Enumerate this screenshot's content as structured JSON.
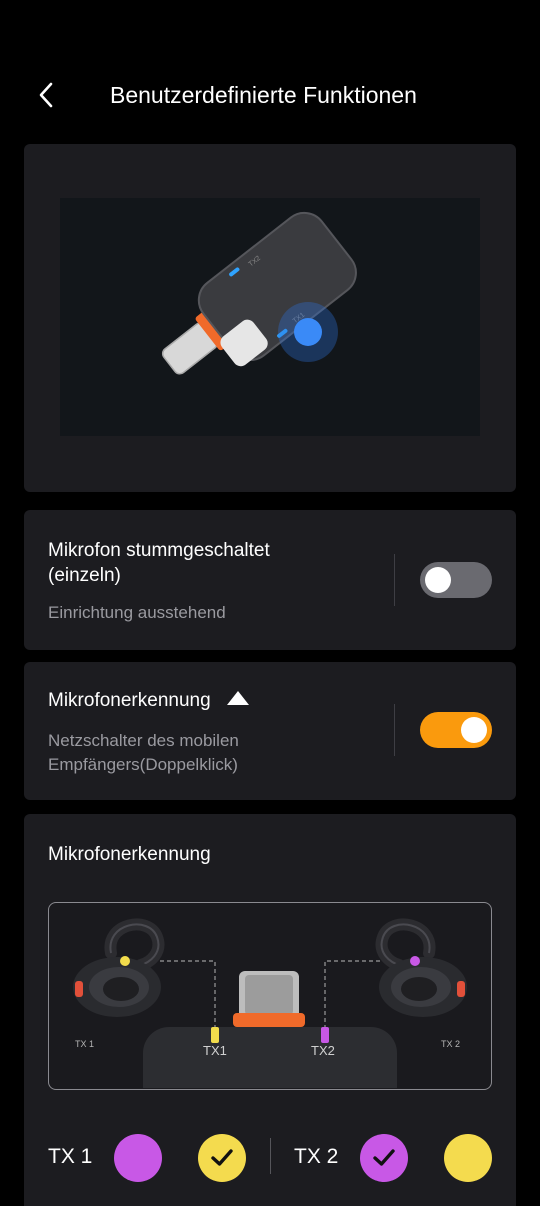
{
  "header": {
    "title": "Benutzerdefinierte Funktionen",
    "back_icon": "chevron-left-icon"
  },
  "hero": {
    "image": "usb-c-receiver-illustration",
    "led_labels": [
      "TX2",
      "TX1"
    ]
  },
  "mute_card": {
    "title": "Mikrofon stummgeschaltet (einzeln)",
    "subtitle": "Einrichtung ausstehend",
    "toggle_on": false
  },
  "detection_toggle_card": {
    "title": "Mikrofonerkennung",
    "subtitle": "Netzschalter des mobilen Empfängers(Doppelklick)",
    "toggle_on": true
  },
  "detection_card": {
    "title": "Mikrofonerkennung",
    "diagram_labels": {
      "left_mic": "TX 1",
      "right_mic": "TX 2",
      "port_left": "TX1",
      "port_right": "TX2"
    },
    "tx1": {
      "label": "TX 1",
      "color_a": "#c858e6",
      "color_b": "#f4db4e",
      "selected": "color_b"
    },
    "tx2": {
      "label": "TX 2",
      "color_a": "#c858e6",
      "color_b": "#f4db4e",
      "selected": "color_a"
    }
  },
  "colors": {
    "accent": "#fa9a0d",
    "card": "#1c1c20",
    "purple": "#c858e6",
    "yellow": "#f4db4e"
  }
}
